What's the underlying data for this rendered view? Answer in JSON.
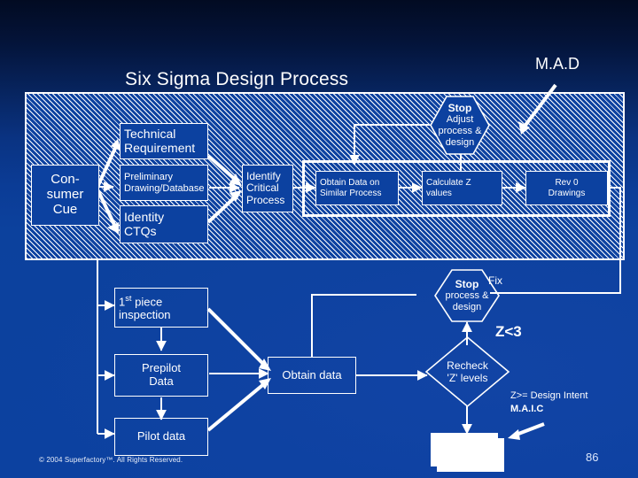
{
  "slide": {
    "title": "Six Sigma Design Process",
    "top_right_label": "M.A.D",
    "page_number": "86",
    "copyright": "© 2004 Superfactory™.  All Rights Reserved.",
    "colors": {
      "background_top": "#020b22",
      "background_bottom": "#0c41a0",
      "line": "#ffffff",
      "box_fill": "#0c41a0",
      "white_box": "#ffffff"
    }
  },
  "boxes": {
    "consumer_cue": {
      "lines": [
        "Con-",
        "sumer",
        "Cue"
      ]
    },
    "technical_requirement": {
      "lines": [
        "Technical",
        "Requirement"
      ]
    },
    "preliminary_drawing": {
      "lines": [
        "Preliminary",
        "Drawing/Database"
      ]
    },
    "identity_ctqs": {
      "lines": [
        "Identity",
        "CTQs"
      ]
    },
    "identify_critical_process": {
      "lines": [
        "Identify",
        "Critical",
        "Process"
      ]
    },
    "obtain_data_similar": {
      "lines": [
        "Obtain Data on",
        "Similar Process"
      ]
    },
    "calculate_z": {
      "lines": [
        "Calculate Z",
        "values"
      ]
    },
    "rev0_drawings": {
      "lines": [
        "Rev 0",
        "Drawings"
      ]
    },
    "first_piece_inspection": {
      "line1_prefix": "1",
      "line1_sup": "st",
      "line1_suffix": " piece",
      "line2": "inspection"
    },
    "prepilot_data": {
      "lines": [
        "Prepilot",
        "Data"
      ]
    },
    "pilot_data": {
      "lines": [
        "Pilot data"
      ]
    },
    "obtain_data": {
      "lines": [
        "Obtain data"
      ]
    },
    "blank_white_box": {
      "lines": [
        ""
      ]
    }
  },
  "shapes": {
    "stop_top": {
      "title": "Stop",
      "lines": [
        "Adjust",
        "process &",
        "design"
      ]
    },
    "stop_bottom": {
      "title": "Stop",
      "lines": [
        "process &",
        "design"
      ]
    },
    "recheck_z": {
      "lines": [
        "Recheck",
        "'Z' levels"
      ]
    }
  },
  "labels": {
    "fix": "Fix",
    "z_less_than_3": "Z<3",
    "z_ge_design_intent": "Z>= Design Intent",
    "maic": "M.A.I.C"
  }
}
